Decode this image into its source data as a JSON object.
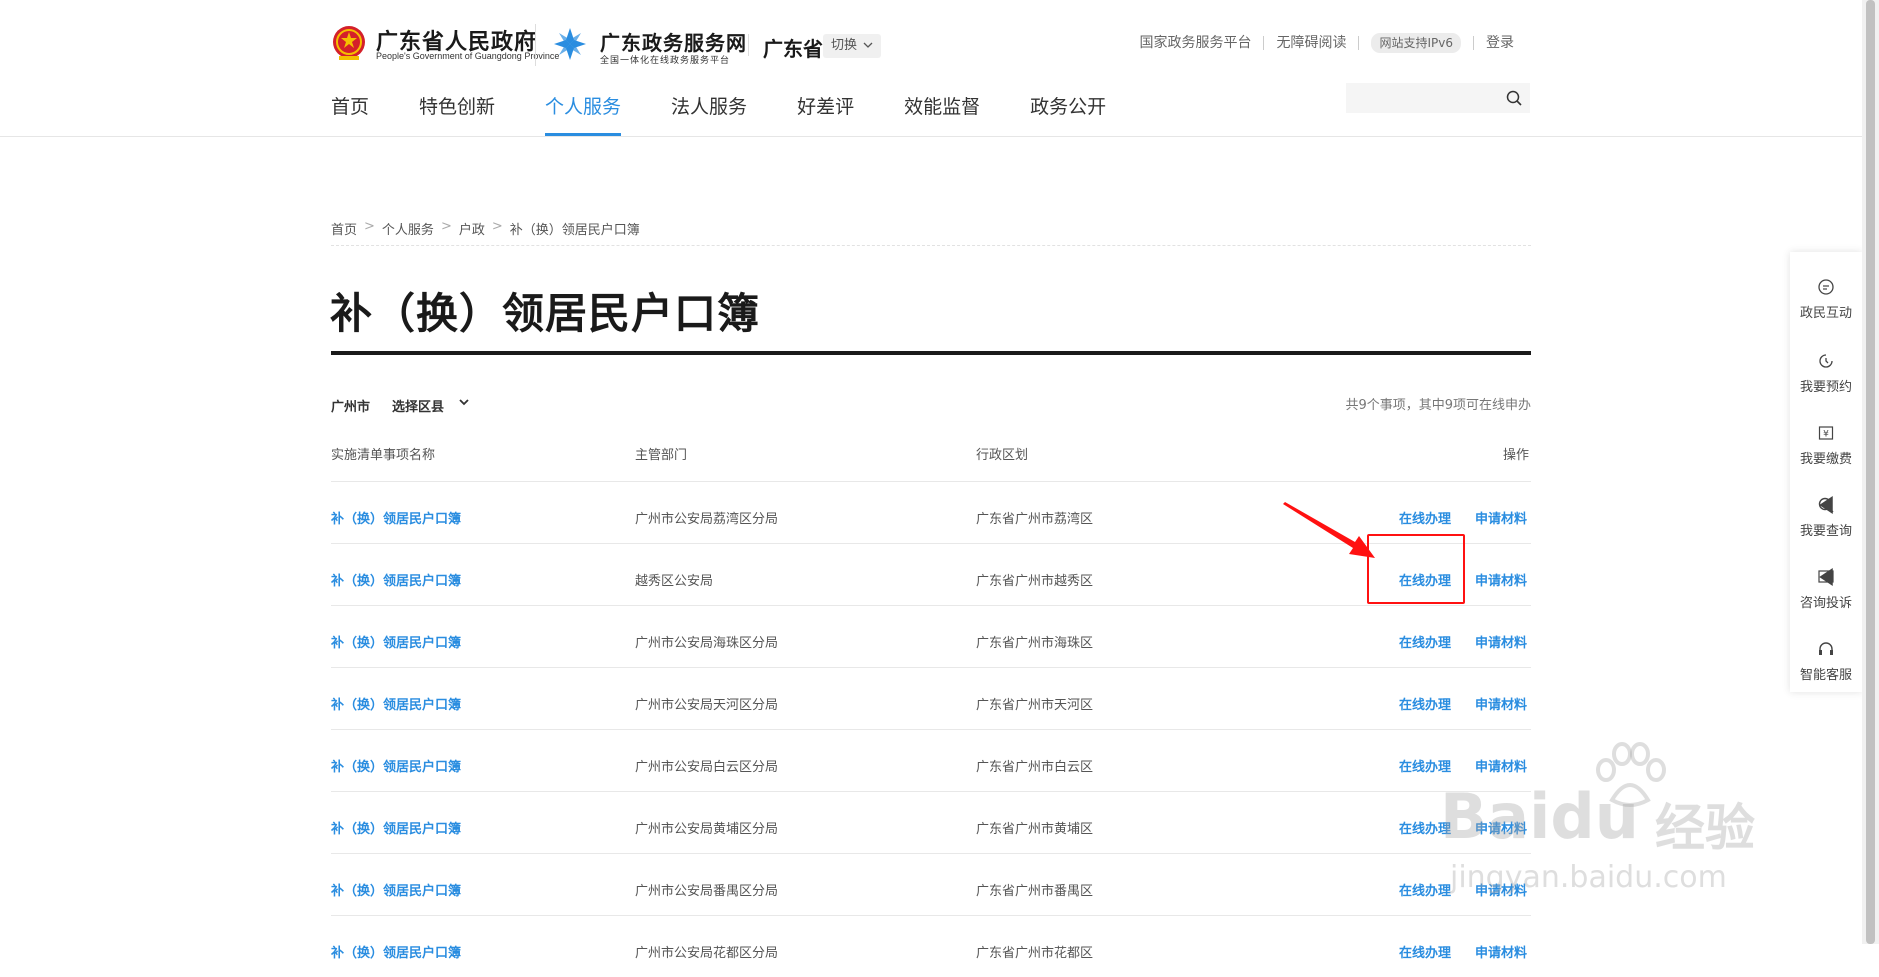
{
  "header": {
    "gov_title": "广东省人民政府",
    "gov_subtitle": "People's Government of Guangdong Province",
    "service_title": "广东政务服务网",
    "service_subtitle": "全国一体化在线政务服务平台",
    "province": "广东省",
    "switch_label": "切换",
    "top_links": [
      "国家政务服务平台",
      "无障碍阅读",
      "网站支持IPv6",
      "登录"
    ],
    "nav": [
      "首页",
      "特色创新",
      "个人服务",
      "法人服务",
      "好差评",
      "效能监督",
      "政务公开"
    ],
    "nav_active": "个人服务",
    "search_placeholder": "",
    "brand_color": "#2a8de0"
  },
  "breadcrumb": [
    "首页",
    "个人服务",
    "户政",
    "补（换）领居民户口簿"
  ],
  "page_title": "补（换）领居民户口簿",
  "filter": {
    "city": "广州市",
    "district": "选择区县"
  },
  "summary": "共9个事项，其中9项可在线申办",
  "table": {
    "headers": [
      "实施清单事项名称",
      "主管部门",
      "行政区划",
      "操作"
    ],
    "rows": [
      {
        "name": "补（换）领居民户口簿",
        "dept": "广州市公安局荔湾区分局",
        "region": "广东省广州市荔湾区",
        "online": "在线办理",
        "material": "申请材料"
      },
      {
        "name": "补（换）领居民户口簿",
        "dept": "越秀区公安局",
        "region": "广东省广州市越秀区",
        "online": "在线办理",
        "material": "申请材料"
      },
      {
        "name": "补（换）领居民户口簿",
        "dept": "广州市公安局海珠区分局",
        "region": "广东省广州市海珠区",
        "online": "在线办理",
        "material": "申请材料"
      },
      {
        "name": "补（换）领居民户口簿",
        "dept": "广州市公安局天河区分局",
        "region": "广东省广州市天河区",
        "online": "在线办理",
        "material": "申请材料"
      },
      {
        "name": "补（换）领居民户口簿",
        "dept": "广州市公安局白云区分局",
        "region": "广东省广州市白云区",
        "online": "在线办理",
        "material": "申请材料"
      },
      {
        "name": "补（换）领居民户口簿",
        "dept": "广州市公安局黄埔区分局",
        "region": "广东省广州市黄埔区",
        "online": "在线办理",
        "material": "申请材料"
      },
      {
        "name": "补（换）领居民户口簿",
        "dept": "广州市公安局番禺区分局",
        "region": "广东省广州市番禺区",
        "online": "在线办理",
        "material": "申请材料"
      },
      {
        "name": "补（换）领居民户口簿",
        "dept": "广州市公安局花都区分局",
        "region": "广东省广州市花都区",
        "online": "在线办理",
        "material": "申请材料"
      }
    ]
  },
  "sidebar": [
    "政民互动",
    "我要预约",
    "我要缴费",
    "我要查询",
    "咨询投诉",
    "智能客服"
  ],
  "watermark": {
    "brand": "Baidu",
    "brand_cn": "经验",
    "url": "jingyan.baidu.com"
  },
  "annotation_color": "#ff1111"
}
